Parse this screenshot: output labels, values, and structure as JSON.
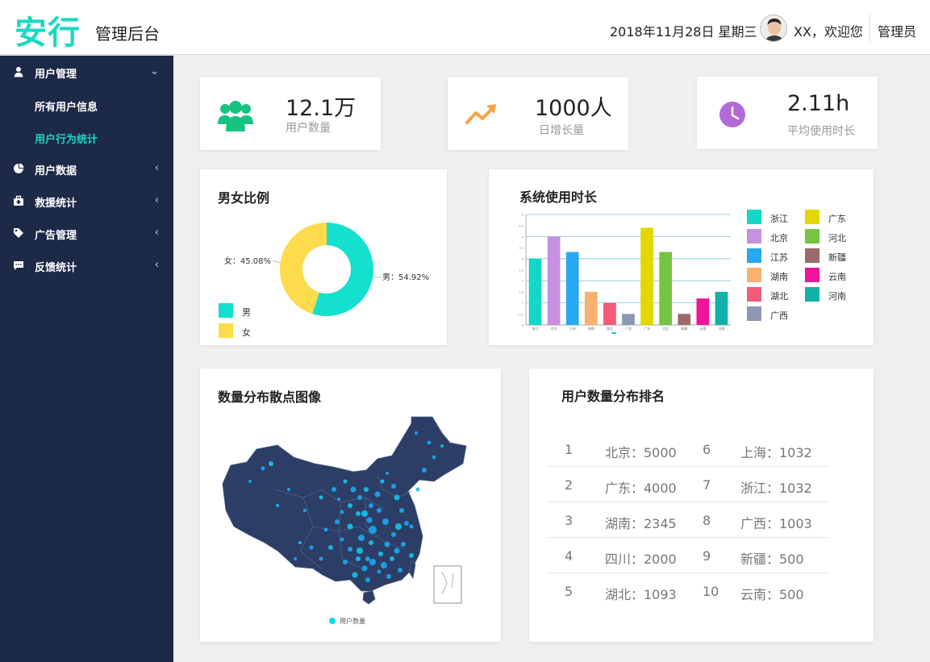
{
  "header": {
    "logo": "安行",
    "subtitle": "管理后台",
    "date": "2018年11月28日 星期三",
    "welcome": "XX，欢迎您",
    "role": "管理员"
  },
  "sidebar": {
    "items": [
      {
        "label": "用户管理",
        "icon": "user-icon",
        "arrow": "⌄"
      },
      {
        "label": "用户数据",
        "icon": "pie-chart-icon",
        "arrow": "‹"
      },
      {
        "label": "救援统计",
        "icon": "medkit-icon",
        "arrow": "‹"
      },
      {
        "label": "广告管理",
        "icon": "tag-icon",
        "arrow": "‹"
      },
      {
        "label": "反馈统计",
        "icon": "comment-icon",
        "arrow": "‹"
      }
    ],
    "subitems": [
      {
        "label": "所有用户信息",
        "active": false
      },
      {
        "label": "用户行为统计",
        "active": true
      }
    ]
  },
  "stats": [
    {
      "value": "12.1万",
      "label": "用户数量",
      "icon": "users-icon",
      "color": "#17c47f"
    },
    {
      "value": "1000人",
      "label": "日增长量",
      "icon": "trend-up-icon",
      "color": "#f6a34a"
    },
    {
      "value": "2.11h",
      "label": "平均使用时长",
      "icon": "clock-icon",
      "color": "#b36ad9"
    }
  ],
  "gender": {
    "title": "男女比例",
    "female_label": "女：45.08%",
    "male_label": "男：54.92%",
    "legend": [
      "男",
      "女"
    ]
  },
  "usage": {
    "title": "系统使用时长"
  },
  "map": {
    "title": "数量分布散点图像",
    "legend": "用户数量"
  },
  "ranking": {
    "title": "用户数量分布排名",
    "left": [
      {
        "rank": "1",
        "text": "北京：5000"
      },
      {
        "rank": "2",
        "text": "广东：4000"
      },
      {
        "rank": "3",
        "text": "湖南：2345"
      },
      {
        "rank": "4",
        "text": "四川：2000"
      },
      {
        "rank": "5",
        "text": "湖北：1093"
      }
    ],
    "right": [
      {
        "rank": "6",
        "text": "上海：1032"
      },
      {
        "rank": "7",
        "text": "浙江：1032"
      },
      {
        "rank": "8",
        "text": "广西：1003"
      },
      {
        "rank": "9",
        "text": "新疆：500"
      },
      {
        "rank": "10",
        "text": "云南：500"
      }
    ]
  },
  "chart_data": [
    {
      "type": "pie",
      "title": "男女比例",
      "series": [
        {
          "name": "男",
          "value": 54.92,
          "color": "#13e0cf"
        },
        {
          "name": "女",
          "value": 45.08,
          "color": "#fddb4a"
        }
      ]
    },
    {
      "type": "bar",
      "title": "系统使用时长",
      "categories": [
        "浙江",
        "北京",
        "江苏",
        "湖南",
        "湖北",
        "广西",
        "广东",
        "河北",
        "新疆",
        "云南",
        "河南"
      ],
      "values": [
        3.0,
        4.0,
        3.3,
        1.5,
        1.0,
        0.5,
        4.4,
        3.3,
        0.5,
        1.2,
        1.5
      ],
      "colors": [
        "#13d8c8",
        "#c790e0",
        "#27a8f0",
        "#f8b16e",
        "#f25b7a",
        "#8d98b3",
        "#e2d700",
        "#76c442",
        "#9c6a6a",
        "#f0139c",
        "#13b2a8"
      ],
      "ylim": [
        0,
        5
      ],
      "yticks": [
        "0",
        "0.5",
        "1",
        "1.5",
        "2",
        "2.5",
        "3",
        "3.5",
        "4",
        "4.5",
        "5"
      ],
      "legend_position": "right"
    }
  ]
}
